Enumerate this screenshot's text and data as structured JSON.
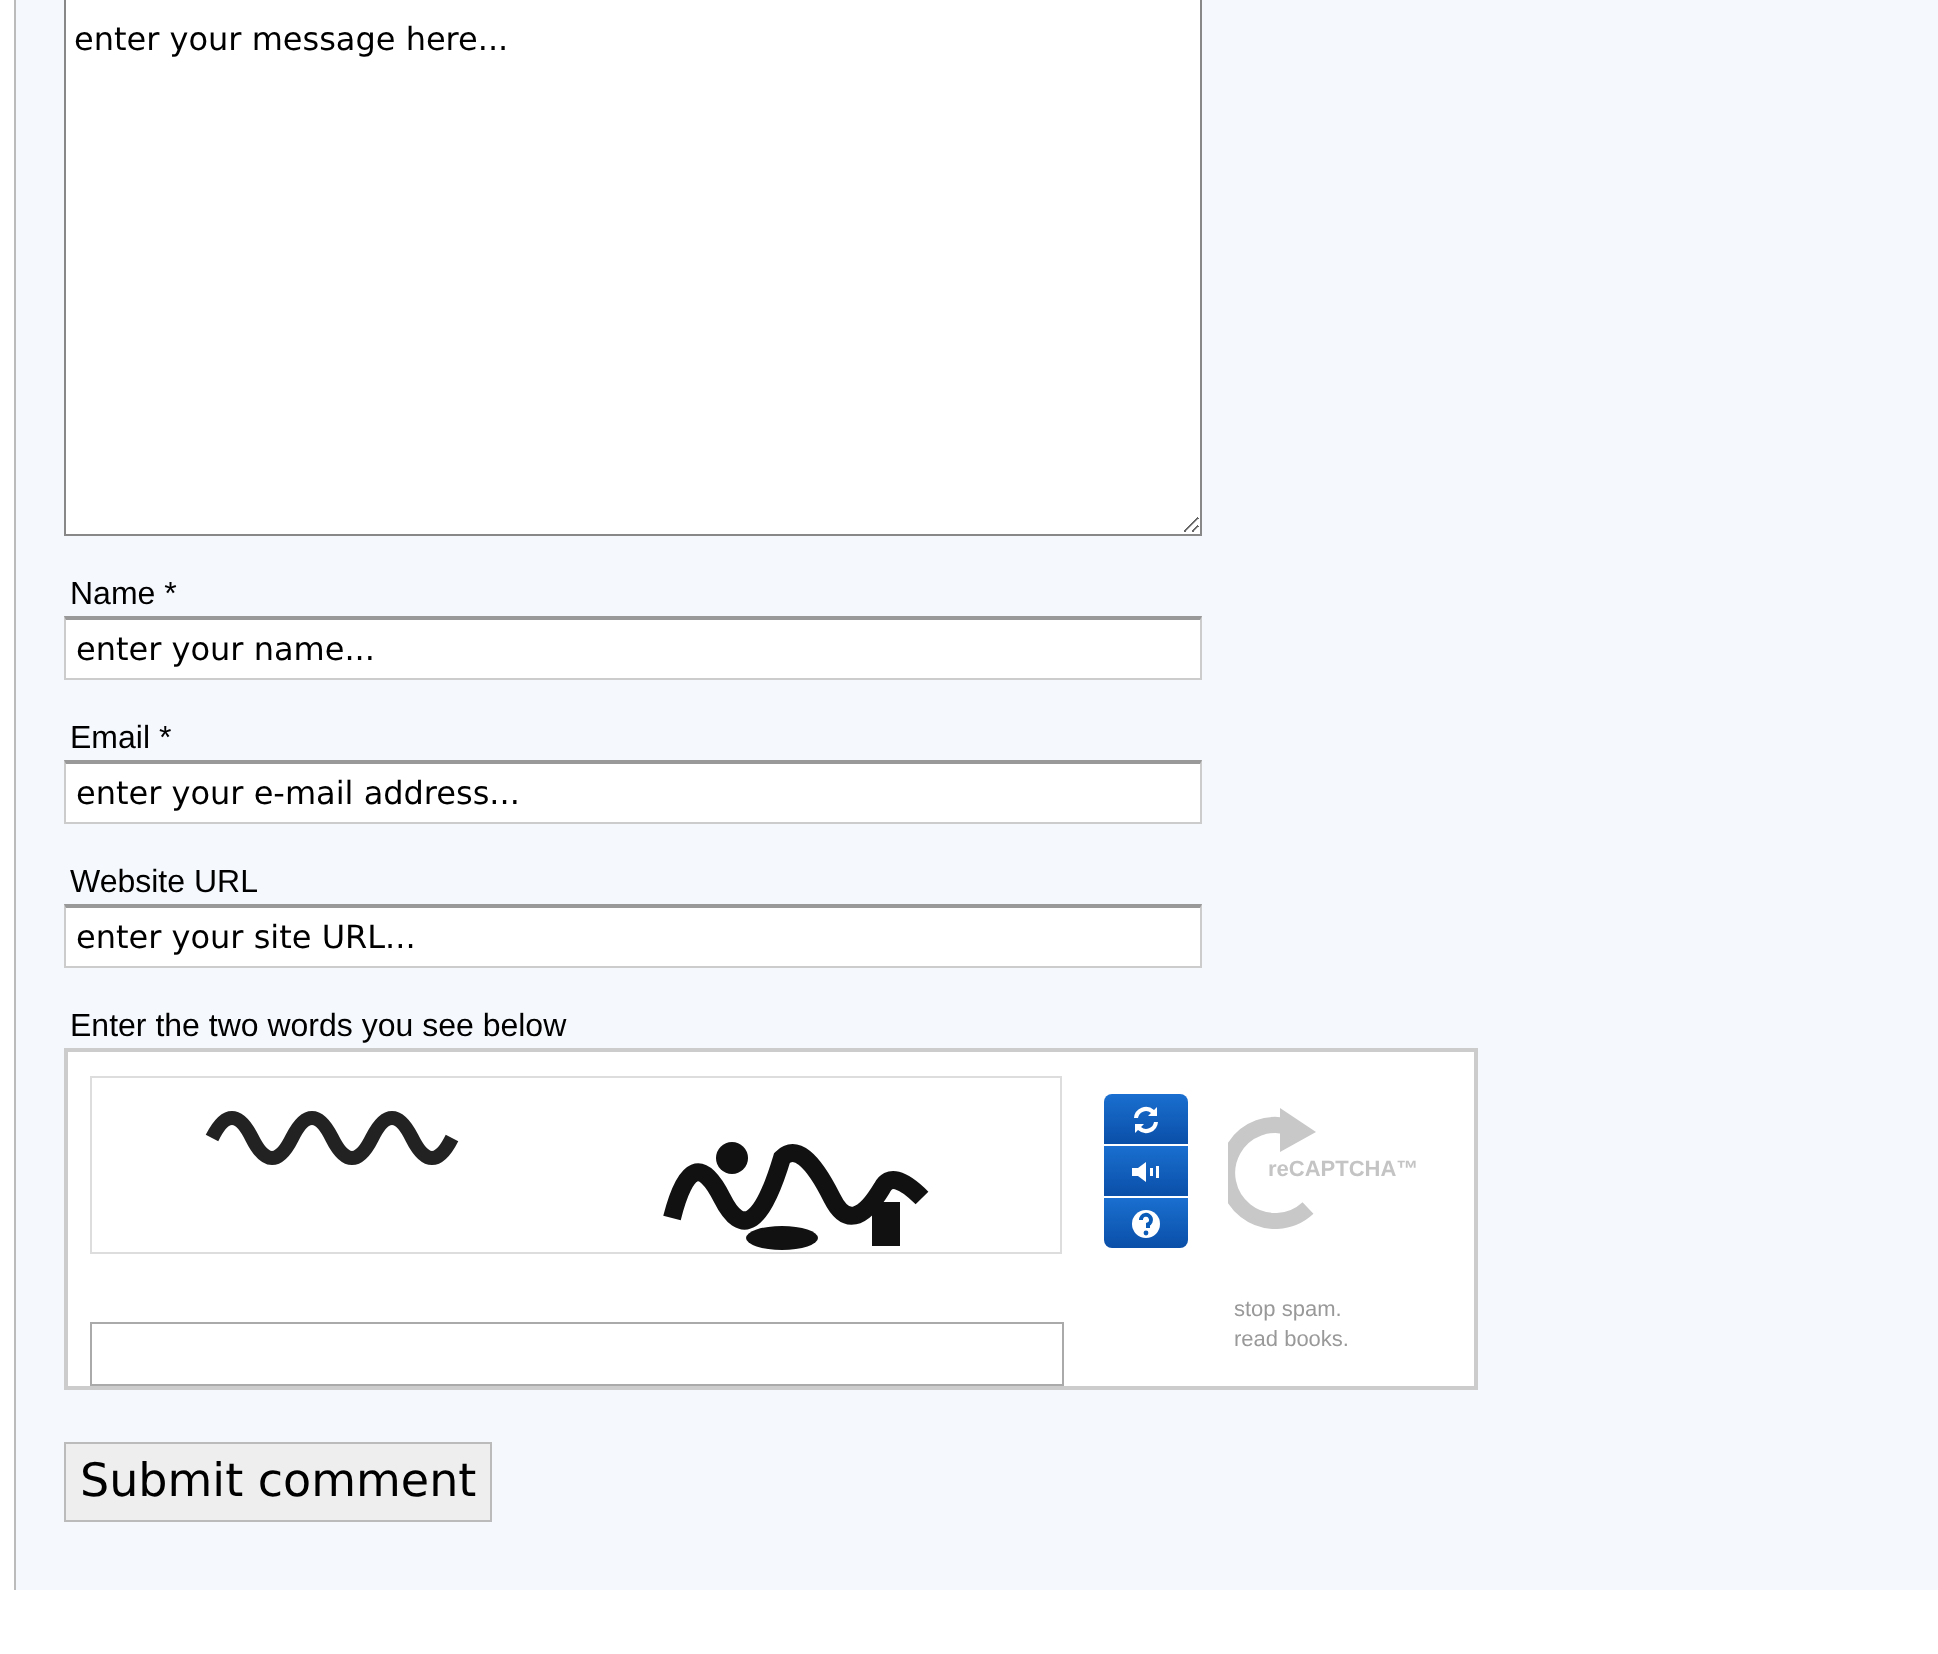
{
  "message": {
    "value": "enter your message here..."
  },
  "fields": [
    {
      "label": "Name *",
      "value": "enter your name..."
    },
    {
      "label": "Email *",
      "value": "enter your e-mail address..."
    },
    {
      "label": "Website URL",
      "value": "enter your site URL..."
    }
  ],
  "captcha": {
    "label": "Enter the two words you see below",
    "logo": "reCAPTCHA™",
    "tagline": "stop spam. read books.",
    "buttons": [
      {
        "kind": "reload"
      },
      {
        "kind": "audio"
      },
      {
        "kind": "help"
      }
    ]
  },
  "submit": "Submit comment"
}
